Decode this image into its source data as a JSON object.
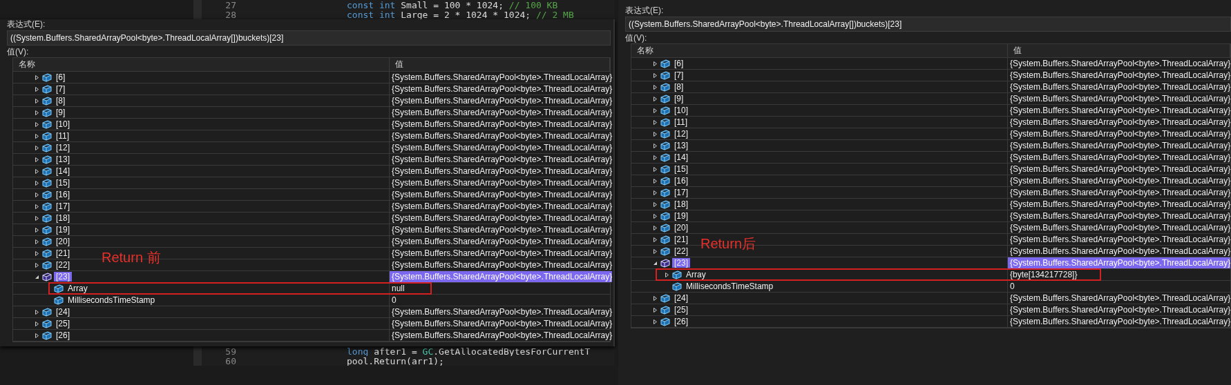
{
  "code_top": [
    {
      "line": "27",
      "tokens": [
        {
          "text": "const int ",
          "kind": "keyword"
        },
        {
          "text": "Small = 100 * 1024; ",
          "kind": "plain"
        },
        {
          "text": "// 100 KB",
          "kind": "comment"
        }
      ]
    },
    {
      "line": "28",
      "tokens": [
        {
          "text": "const int ",
          "kind": "keyword"
        },
        {
          "text": "Large = 2 * 1024 * 1024; ",
          "kind": "plain"
        },
        {
          "text": "// 2 MB",
          "kind": "comment"
        }
      ]
    }
  ],
  "code_bottom": [
    {
      "line": "59",
      "tokens": [
        {
          "text": "long ",
          "kind": "keyword"
        },
        {
          "text": "after1 = ",
          "kind": "plain"
        },
        {
          "text": "GC",
          "kind": "type"
        },
        {
          "text": ".GetAllocatedBytesForCurrentT",
          "kind": "plain"
        }
      ]
    },
    {
      "line": "60",
      "tokens": [
        {
          "text": "pool.Return(arr1);",
          "kind": "plain"
        }
      ]
    }
  ],
  "panels": [
    {
      "expression_label": "表达式(E):",
      "expression": "((System.Buffers.SharedArrayPool<byte>.ThreadLocalArray[])buckets)[23]",
      "value_label": "值(V):",
      "columns": [
        "名称",
        "值"
      ],
      "annotation": "Return 前",
      "rows": [
        {
          "name": "[6]",
          "value": "{System.Buffers.SharedArrayPool<byte>.ThreadLocalArray}",
          "expanded": false,
          "selected": false,
          "outlined": false
        },
        {
          "name": "[7]",
          "value": "{System.Buffers.SharedArrayPool<byte>.ThreadLocalArray}",
          "expanded": false,
          "selected": false,
          "outlined": false
        },
        {
          "name": "[8]",
          "value": "{System.Buffers.SharedArrayPool<byte>.ThreadLocalArray}",
          "expanded": false,
          "selected": false,
          "outlined": false
        },
        {
          "name": "[9]",
          "value": "{System.Buffers.SharedArrayPool<byte>.ThreadLocalArray}",
          "expanded": false,
          "selected": false,
          "outlined": false
        },
        {
          "name": "[10]",
          "value": "{System.Buffers.SharedArrayPool<byte>.ThreadLocalArray}",
          "expanded": false,
          "selected": false,
          "outlined": false
        },
        {
          "name": "[11]",
          "value": "{System.Buffers.SharedArrayPool<byte>.ThreadLocalArray}",
          "expanded": false,
          "selected": false,
          "outlined": false
        },
        {
          "name": "[12]",
          "value": "{System.Buffers.SharedArrayPool<byte>.ThreadLocalArray}",
          "expanded": false,
          "selected": false,
          "outlined": false
        },
        {
          "name": "[13]",
          "value": "{System.Buffers.SharedArrayPool<byte>.ThreadLocalArray}",
          "expanded": false,
          "selected": false,
          "outlined": false
        },
        {
          "name": "[14]",
          "value": "{System.Buffers.SharedArrayPool<byte>.ThreadLocalArray}",
          "expanded": false,
          "selected": false,
          "outlined": false
        },
        {
          "name": "[15]",
          "value": "{System.Buffers.SharedArrayPool<byte>.ThreadLocalArray}",
          "expanded": false,
          "selected": false,
          "outlined": false
        },
        {
          "name": "[16]",
          "value": "{System.Buffers.SharedArrayPool<byte>.ThreadLocalArray}",
          "expanded": false,
          "selected": false,
          "outlined": false
        },
        {
          "name": "[17]",
          "value": "{System.Buffers.SharedArrayPool<byte>.ThreadLocalArray}",
          "expanded": false,
          "selected": false,
          "outlined": false
        },
        {
          "name": "[18]",
          "value": "{System.Buffers.SharedArrayPool<byte>.ThreadLocalArray}",
          "expanded": false,
          "selected": false,
          "outlined": false
        },
        {
          "name": "[19]",
          "value": "{System.Buffers.SharedArrayPool<byte>.ThreadLocalArray}",
          "expanded": false,
          "selected": false,
          "outlined": false
        },
        {
          "name": "[20]",
          "value": "{System.Buffers.SharedArrayPool<byte>.ThreadLocalArray}",
          "expanded": false,
          "selected": false,
          "outlined": false
        },
        {
          "name": "[21]",
          "value": "{System.Buffers.SharedArrayPool<byte>.ThreadLocalArray}",
          "expanded": false,
          "selected": false,
          "outlined": false
        },
        {
          "name": "[22]",
          "value": "{System.Buffers.SharedArrayPool<byte>.ThreadLocalArray}",
          "expanded": false,
          "selected": false,
          "outlined": false
        },
        {
          "name": "[23]",
          "value": "{System.Buffers.SharedArrayPool<byte>.ThreadLocalArray}",
          "expanded": true,
          "selected": true,
          "outlined": false,
          "children": [
            {
              "name": "Array",
              "value": "null",
              "selected": false,
              "outlined": true
            },
            {
              "name": "MillisecondsTimeStamp",
              "value": "0",
              "selected": false,
              "outlined": false
            }
          ]
        },
        {
          "name": "[24]",
          "value": "{System.Buffers.SharedArrayPool<byte>.ThreadLocalArray}",
          "expanded": false,
          "selected": false,
          "outlined": false
        },
        {
          "name": "[25]",
          "value": "{System.Buffers.SharedArrayPool<byte>.ThreadLocalArray}",
          "expanded": false,
          "selected": false,
          "outlined": false
        },
        {
          "name": "[26]",
          "value": "{System.Buffers.SharedArrayPool<byte>.ThreadLocalArray}",
          "expanded": false,
          "selected": false,
          "outlined": false
        }
      ]
    },
    {
      "expression_label": "表达式(E):",
      "expression": "((System.Buffers.SharedArrayPool<byte>.ThreadLocalArray[])buckets)[23]",
      "value_label": "值(V):",
      "columns": [
        "名称",
        "值"
      ],
      "annotation": "Return后",
      "rows": [
        {
          "name": "[6]",
          "value": "{System.Buffers.SharedArrayPool<byte>.ThreadLocalArray}",
          "expanded": false,
          "selected": false,
          "outlined": false
        },
        {
          "name": "[7]",
          "value": "{System.Buffers.SharedArrayPool<byte>.ThreadLocalArray}",
          "expanded": false,
          "selected": false,
          "outlined": false
        },
        {
          "name": "[8]",
          "value": "{System.Buffers.SharedArrayPool<byte>.ThreadLocalArray}",
          "expanded": false,
          "selected": false,
          "outlined": false
        },
        {
          "name": "[9]",
          "value": "{System.Buffers.SharedArrayPool<byte>.ThreadLocalArray}",
          "expanded": false,
          "selected": false,
          "outlined": false
        },
        {
          "name": "[10]",
          "value": "{System.Buffers.SharedArrayPool<byte>.ThreadLocalArray}",
          "expanded": false,
          "selected": false,
          "outlined": false
        },
        {
          "name": "[11]",
          "value": "{System.Buffers.SharedArrayPool<byte>.ThreadLocalArray}",
          "expanded": false,
          "selected": false,
          "outlined": false
        },
        {
          "name": "[12]",
          "value": "{System.Buffers.SharedArrayPool<byte>.ThreadLocalArray}",
          "expanded": false,
          "selected": false,
          "outlined": false
        },
        {
          "name": "[13]",
          "value": "{System.Buffers.SharedArrayPool<byte>.ThreadLocalArray}",
          "expanded": false,
          "selected": false,
          "outlined": false
        },
        {
          "name": "[14]",
          "value": "{System.Buffers.SharedArrayPool<byte>.ThreadLocalArray}",
          "expanded": false,
          "selected": false,
          "outlined": false
        },
        {
          "name": "[15]",
          "value": "{System.Buffers.SharedArrayPool<byte>.ThreadLocalArray}",
          "expanded": false,
          "selected": false,
          "outlined": false
        },
        {
          "name": "[16]",
          "value": "{System.Buffers.SharedArrayPool<byte>.ThreadLocalArray}",
          "expanded": false,
          "selected": false,
          "outlined": false
        },
        {
          "name": "[17]",
          "value": "{System.Buffers.SharedArrayPool<byte>.ThreadLocalArray}",
          "expanded": false,
          "selected": false,
          "outlined": false
        },
        {
          "name": "[18]",
          "value": "{System.Buffers.SharedArrayPool<byte>.ThreadLocalArray}",
          "expanded": false,
          "selected": false,
          "outlined": false
        },
        {
          "name": "[19]",
          "value": "{System.Buffers.SharedArrayPool<byte>.ThreadLocalArray}",
          "expanded": false,
          "selected": false,
          "outlined": false
        },
        {
          "name": "[20]",
          "value": "{System.Buffers.SharedArrayPool<byte>.ThreadLocalArray}",
          "expanded": false,
          "selected": false,
          "outlined": false
        },
        {
          "name": "[21]",
          "value": "{System.Buffers.SharedArrayPool<byte>.ThreadLocalArray}",
          "expanded": false,
          "selected": false,
          "outlined": false
        },
        {
          "name": "[22]",
          "value": "{System.Buffers.SharedArrayPool<byte>.ThreadLocalArray}",
          "expanded": false,
          "selected": false,
          "outlined": false
        },
        {
          "name": "[23]",
          "value": "{System.Buffers.SharedArrayPool<byte>.ThreadLocalArray}",
          "expanded": true,
          "selected": true,
          "outlined": false,
          "children": [
            {
              "name": "Array",
              "value": "{byte[134217728]}",
              "expanded": false,
              "selected": false,
              "outlined": true
            },
            {
              "name": "MillisecondsTimeStamp",
              "value": "0",
              "selected": false,
              "outlined": false
            }
          ]
        },
        {
          "name": "[24]",
          "value": "{System.Buffers.SharedArrayPool<byte>.ThreadLocalArray}",
          "expanded": false,
          "selected": false,
          "outlined": false
        },
        {
          "name": "[25]",
          "value": "{System.Buffers.SharedArrayPool<byte>.ThreadLocalArray}",
          "expanded": false,
          "selected": false,
          "outlined": false
        },
        {
          "name": "[26]",
          "value": "{System.Buffers.SharedArrayPool<byte>.ThreadLocalArray}",
          "expanded": false,
          "selected": false,
          "outlined": false
        }
      ]
    }
  ]
}
